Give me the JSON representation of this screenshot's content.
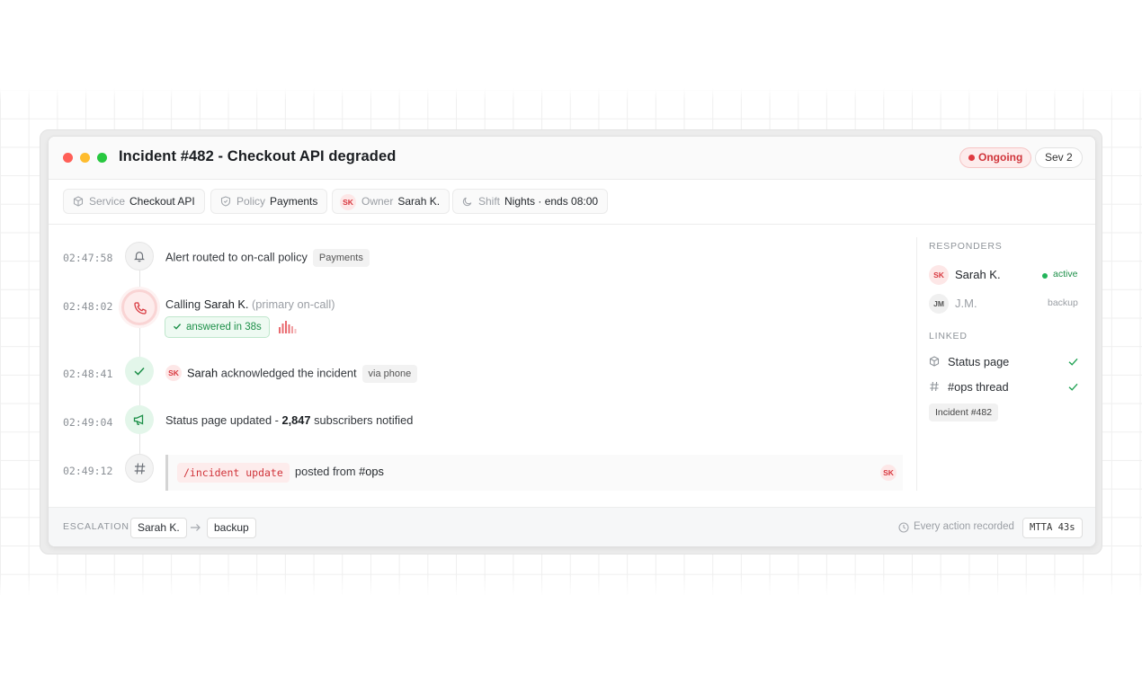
{
  "window": {
    "title": "Incident #482 - Checkout API degraded",
    "status_badge": "Ongoing",
    "severity_badge": "Sev 2"
  },
  "meta": {
    "service_key": "Service",
    "service_val": "Checkout API",
    "policy_key": "Policy",
    "policy_val": "Payments",
    "owner_initials": "SK",
    "owner_key": "Owner",
    "owner_val": "Sarah K.",
    "shift_key": "Shift",
    "shift_val": "Nights · ends 08:00"
  },
  "timeline": [
    {
      "time": "02:47:58",
      "text": "Alert routed to on-call policy",
      "tag": "Payments",
      "icon": "bell-icon"
    },
    {
      "time": "02:48:02",
      "pre": "Calling ",
      "name": "Sarah K.",
      "note": " (primary on-call)",
      "answered": "answered in 38s",
      "icon": "phone-icon"
    },
    {
      "time": "02:48:41",
      "initials": "SK",
      "name": "Sarah",
      "text": " acknowledged the incident",
      "tag": "via phone",
      "icon": "check-icon"
    },
    {
      "time": "02:49:04",
      "text": "Status page updated - ",
      "count": "2,847",
      "suffix": " subscribers notified",
      "icon": "megaphone-icon"
    },
    {
      "time": "02:49:12",
      "command": "/incident update",
      "text": "posted from ",
      "channel": "#ops",
      "initials": "SK",
      "icon": "hash-icon"
    }
  ],
  "responders": {
    "heading": "RESPONDERS",
    "items": [
      {
        "initials": "SK",
        "name": "Sarah K.",
        "status": "active"
      },
      {
        "initials": "JM",
        "name": "J.M.",
        "status": "backup"
      }
    ]
  },
  "linked": {
    "heading": "LINKED",
    "items": [
      {
        "label": "Status page",
        "icon": "cube-icon"
      },
      {
        "label": "#ops thread",
        "icon": "hash-icon"
      }
    ],
    "tag": "Incident #482"
  },
  "footer": {
    "escalation_label": "ESCALATION",
    "step1": "Sarah K.",
    "step2": "backup",
    "recorded": "Every action recorded",
    "mtta": "MTTA 43s"
  },
  "colors": {
    "accent_red": "#e0393f",
    "accent_green": "#1c8f48",
    "dot_red": "#ff5f57",
    "dot_yellow": "#febc2e",
    "dot_green": "#28c840"
  }
}
